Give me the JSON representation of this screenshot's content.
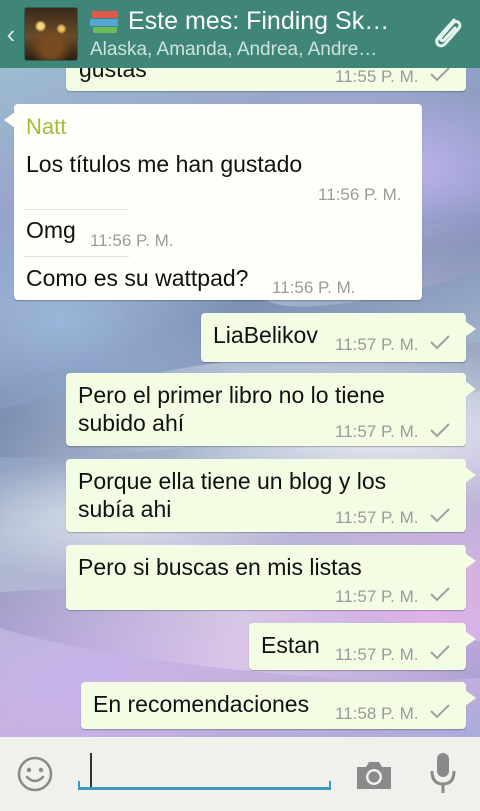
{
  "header": {
    "back_glyph": "‹",
    "title": "Este mes: Finding Sk…",
    "subtitle": "Alaska, Amanda, Andrea, Andre…",
    "avatar_icon": "group-avatar-image",
    "title_icon": "books-icon",
    "attach_icon": "paperclip-icon",
    "color": "#3f8678"
  },
  "messages": [
    {
      "direction": "out",
      "text": "gustas",
      "time": "11:55 P. M.",
      "status": "sent"
    },
    {
      "direction": "in",
      "sender": "Natt",
      "text": "Los títulos me han gustado",
      "time": "11:56 P. M."
    },
    {
      "direction": "in",
      "text": "Omg",
      "time": "11:56 P. M."
    },
    {
      "direction": "in",
      "text": "Como es su wattpad?",
      "time": "11:56 P. M."
    },
    {
      "direction": "out",
      "text": "LiaBelikov",
      "time": "11:57 P. M.",
      "status": "sent"
    },
    {
      "direction": "out",
      "text": "Pero el primer libro no lo tiene subido ahí",
      "time": "11:57 P. M.",
      "status": "sent"
    },
    {
      "direction": "out",
      "text": "Porque ella tiene un blog y los subía ahi",
      "time": "11:57 P. M.",
      "status": "sent"
    },
    {
      "direction": "out",
      "text": "Pero si buscas en mis listas",
      "time": "11:57 P. M.",
      "status": "sent"
    },
    {
      "direction": "out",
      "text": "Estan",
      "time": "11:57 P. M.",
      "status": "sent"
    },
    {
      "direction": "out",
      "text": "En recomendaciones",
      "time": "11:58 P. M.",
      "status": "sent"
    }
  ],
  "input": {
    "value": "",
    "emoji_icon": "emoji-icon",
    "camera_icon": "camera-icon",
    "mic_icon": "microphone-icon"
  },
  "colors": {
    "outgoing_bubble": "#f2fde4",
    "incoming_bubble": "#fffffa",
    "sender_name": "#a6bd3a",
    "input_underline": "#3a9bc2"
  }
}
